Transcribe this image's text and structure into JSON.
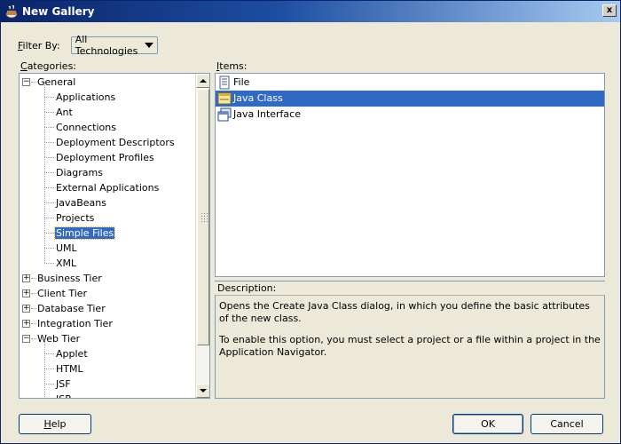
{
  "window": {
    "title": "New Gallery",
    "close_glyph": "x"
  },
  "filter": {
    "label": "Filter By:",
    "label_mnemonic": "F",
    "label_rest": "ilter By:",
    "value": "All Technologies"
  },
  "categories": {
    "label": "Categories:",
    "label_mnemonic": "C",
    "label_rest": "ategories:",
    "nodes": [
      {
        "label": "General",
        "level": 0,
        "expander": "−",
        "expanded": true
      },
      {
        "label": "Applications",
        "level": 1
      },
      {
        "label": "Ant",
        "level": 1
      },
      {
        "label": "Connections",
        "level": 1
      },
      {
        "label": "Deployment Descriptors",
        "level": 1
      },
      {
        "label": "Deployment Profiles",
        "level": 1
      },
      {
        "label": "Diagrams",
        "level": 1
      },
      {
        "label": "External Applications",
        "level": 1
      },
      {
        "label": "JavaBeans",
        "level": 1
      },
      {
        "label": "Projects",
        "level": 1
      },
      {
        "label": "Simple Files",
        "level": 1,
        "selected": true
      },
      {
        "label": "UML",
        "level": 1
      },
      {
        "label": "XML",
        "level": 1
      },
      {
        "label": "Business Tier",
        "level": 0,
        "expander": "+"
      },
      {
        "label": "Client Tier",
        "level": 0,
        "expander": "+"
      },
      {
        "label": "Database Tier",
        "level": 0,
        "expander": "+"
      },
      {
        "label": "Integration Tier",
        "level": 0,
        "expander": "+"
      },
      {
        "label": "Web Tier",
        "level": 0,
        "expander": "−",
        "expanded": true
      },
      {
        "label": "Applet",
        "level": 1
      },
      {
        "label": "HTML",
        "level": 1
      },
      {
        "label": "JSF",
        "level": 1
      },
      {
        "label": "JSP",
        "level": 1
      }
    ]
  },
  "items": {
    "label": "Items:",
    "label_mnemonic": "I",
    "label_rest": "tems:",
    "list": [
      {
        "label": "File",
        "icon": "file-icon"
      },
      {
        "label": "Java Class",
        "icon": "java-class-icon",
        "selected": true
      },
      {
        "label": "Java Interface",
        "icon": "java-interface-icon"
      }
    ]
  },
  "description": {
    "label": "Description:",
    "p1": "Opens the Create Java Class dialog, in which you define the basic attributes of the new class.",
    "p2": "To enable this option, you must select a project or a file within a project in the Application Navigator."
  },
  "buttons": {
    "help_mnemonic": "H",
    "help_rest": "elp",
    "ok": "OK",
    "cancel": "Cancel"
  },
  "colors": {
    "selection": "#316ac5",
    "title_start": "#0a246a",
    "title_end": "#a6caf0",
    "dialog_bg": "#ece9d8"
  }
}
